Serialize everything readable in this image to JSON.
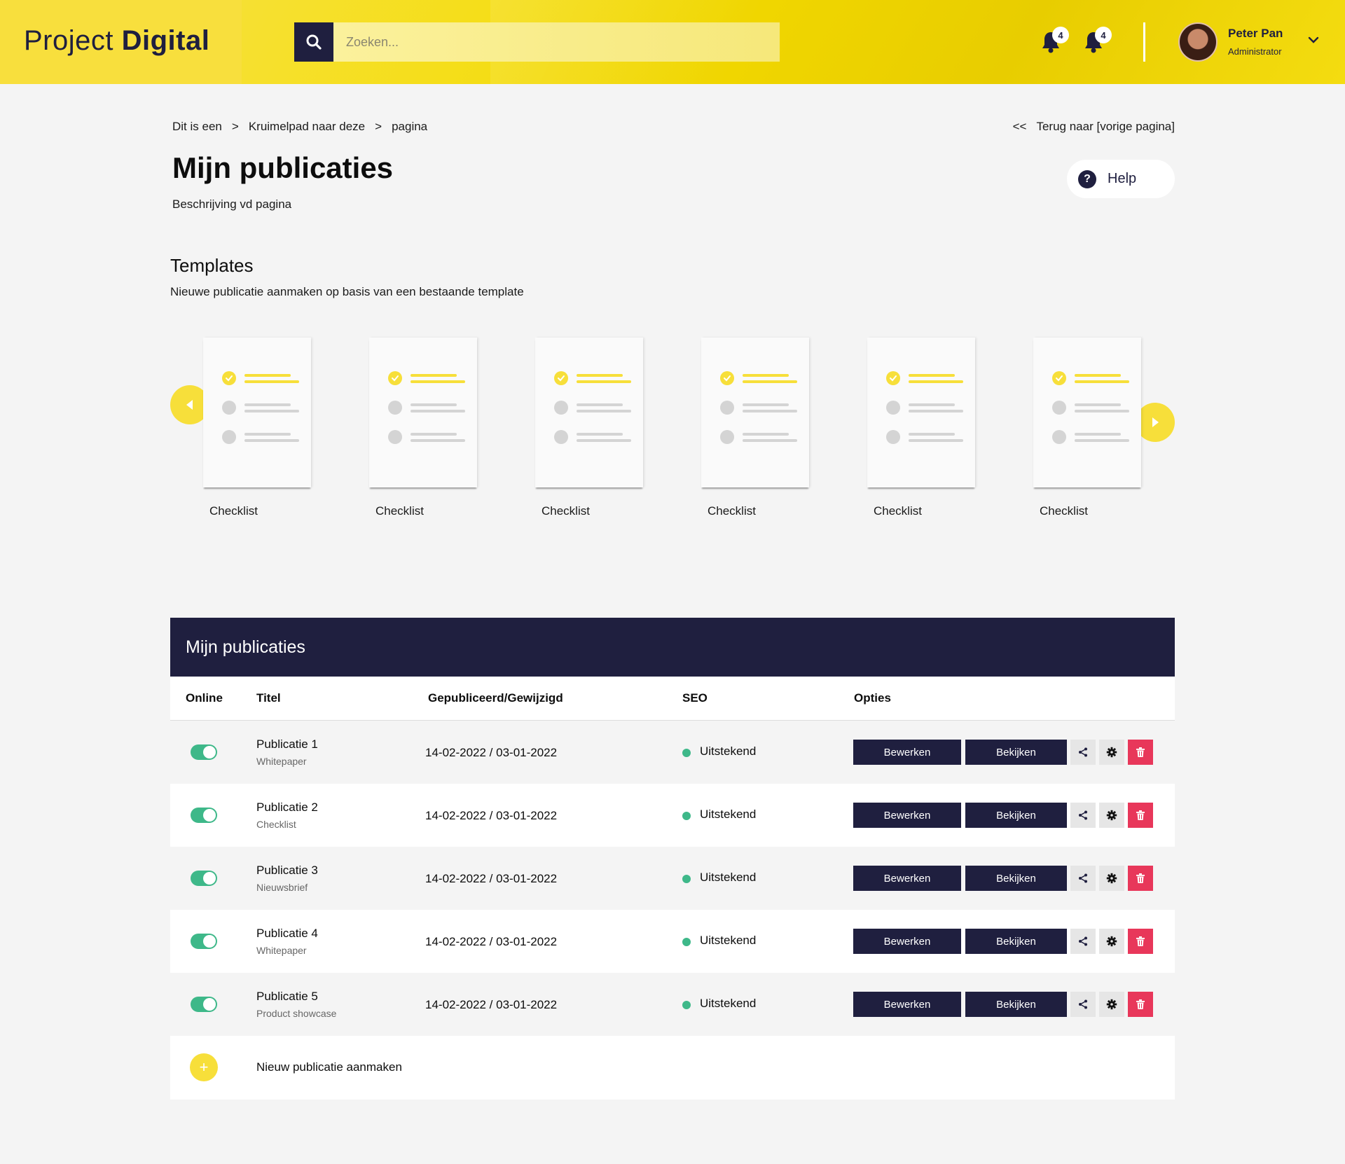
{
  "header": {
    "logo_light": "Project ",
    "logo_bold": "Digital",
    "search_placeholder": "Zoeken...",
    "notifications": [
      {
        "icon": "bell-icon",
        "count": "4"
      },
      {
        "icon": "bell-icon",
        "count": "4"
      }
    ],
    "user": {
      "name": "Peter Pan",
      "role": "Administrator"
    }
  },
  "breadcrumb": {
    "items": [
      "Dit is een",
      "Kruimelpad naar deze",
      "pagina"
    ],
    "separator": ">"
  },
  "back_link": {
    "prefix": "<<",
    "label": "Terug naar [vorige pagina]"
  },
  "page": {
    "title": "Mijn publicaties",
    "description": "Beschrijving vd pagina",
    "help_label": "Help",
    "help_icon": "?"
  },
  "templates": {
    "title": "Templates",
    "description": "Nieuwe publicatie aanmaken op basis van een bestaande template",
    "items": [
      {
        "label": "Checklist"
      },
      {
        "label": "Checklist"
      },
      {
        "label": "Checklist"
      },
      {
        "label": "Checklist"
      },
      {
        "label": "Checklist"
      },
      {
        "label": "Checklist"
      }
    ]
  },
  "table": {
    "heading": "Mijn publicaties",
    "columns": [
      "Online",
      "Titel",
      "Gepubliceerd/Gewijzigd",
      "SEO",
      "Opties"
    ],
    "rows": [
      {
        "title": "Publicatie 1",
        "type": "Whitepaper",
        "dates": "14-02-2022 / 03-01-2022",
        "seo": "Uitstekend",
        "online": true
      },
      {
        "title": "Publicatie 2",
        "type": "Checklist",
        "dates": "14-02-2022 / 03-01-2022",
        "seo": "Uitstekend",
        "online": true
      },
      {
        "title": "Publicatie 3",
        "type": "Nieuwsbrief",
        "dates": "14-02-2022 / 03-01-2022",
        "seo": "Uitstekend",
        "online": true
      },
      {
        "title": "Publicatie 4",
        "type": "Whitepaper",
        "dates": "14-02-2022 / 03-01-2022",
        "seo": "Uitstekend",
        "online": true
      },
      {
        "title": "Publicatie 5",
        "type": "Product showcase",
        "dates": "14-02-2022 / 03-01-2022",
        "seo": "Uitstekend",
        "online": true
      }
    ],
    "edit_label": "Bewerken",
    "view_label": "Bekijken",
    "new_label": "Nieuw publicatie aanmaken",
    "new_icon": "+"
  },
  "colors": {
    "brand_yellow": "#f7df3a",
    "navy": "#1f1f3f",
    "success_green": "#3eb889",
    "danger_red": "#e8375a"
  }
}
